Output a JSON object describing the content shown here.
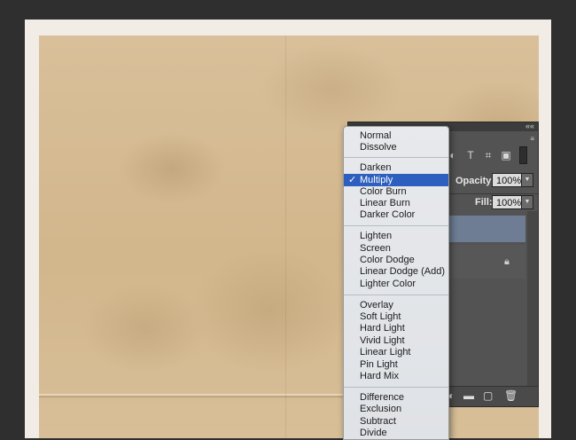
{
  "layers_panel": {
    "collapse_glyph": "««",
    "menu_glyph": "≡",
    "filter_icons": [
      "circle-half-icon",
      "type-icon",
      "transform-icon",
      "smart-object-icon"
    ],
    "opacity_label": "Opacity:",
    "opacity_value": "100%",
    "fill_label": "Fill:",
    "fill_value": "100%"
  },
  "blend_menu": {
    "check": "✓",
    "selected": "Multiply",
    "items": [
      "Normal",
      "Dissolve",
      "Darken",
      "Multiply",
      "Color Burn",
      "Linear Burn",
      "Darker Color",
      "Lighten",
      "Screen",
      "Color Dodge",
      "Linear Dodge (Add)",
      "Lighter Color",
      "Overlay",
      "Soft Light",
      "Hard Light",
      "Vivid Light",
      "Linear Light",
      "Pin Light",
      "Hard Mix",
      "Difference",
      "Exclusion",
      "Subtract",
      "Divide"
    ]
  },
  "colors": {
    "menu_highlight": "#2d5fbf",
    "selected_layer": "#6e7d93",
    "paper": "#d6bb93"
  }
}
